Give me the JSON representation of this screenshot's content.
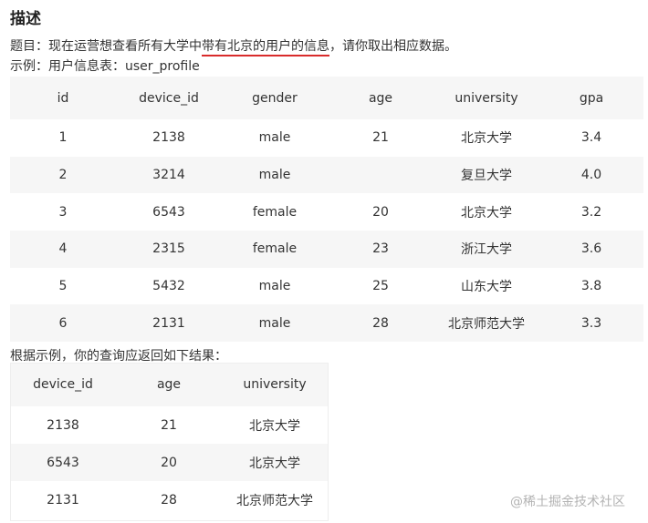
{
  "heading": "描述",
  "question": {
    "prefix": "题目：现在运营想查看所有大学中",
    "highlight": "带有北京的用户的信息",
    "suffix": "，请你取出相应数据。"
  },
  "example_label": "示例：用户信息表：user_profile",
  "user_profile_table": {
    "columns": [
      "id",
      "device_id",
      "gender",
      "age",
      "university",
      "gpa"
    ],
    "rows": [
      [
        "1",
        "2138",
        "male",
        "21",
        "北京大学",
        "3.4"
      ],
      [
        "2",
        "3214",
        "male",
        "",
        "复旦大学",
        "4.0"
      ],
      [
        "3",
        "6543",
        "female",
        "20",
        "北京大学",
        "3.2"
      ],
      [
        "4",
        "2315",
        "female",
        "23",
        "浙江大学",
        "3.6"
      ],
      [
        "5",
        "5432",
        "male",
        "25",
        "山东大学",
        "3.8"
      ],
      [
        "6",
        "2131",
        "male",
        "28",
        "北京师范大学",
        "3.3"
      ]
    ]
  },
  "result_label": "根据示例，你的查询应返回如下结果：",
  "result_table": {
    "columns": [
      "device_id",
      "age",
      "university"
    ],
    "rows": [
      [
        "2138",
        "21",
        "北京大学"
      ],
      [
        "6543",
        "20",
        "北京大学"
      ],
      [
        "2131",
        "28",
        "北京师范大学"
      ]
    ]
  },
  "watermark": "@稀土掘金技术社区",
  "colors": {
    "highlight_underline": "#d92b2b",
    "striped_row": "#f6f6f6",
    "watermark": "#b3b3b3"
  }
}
